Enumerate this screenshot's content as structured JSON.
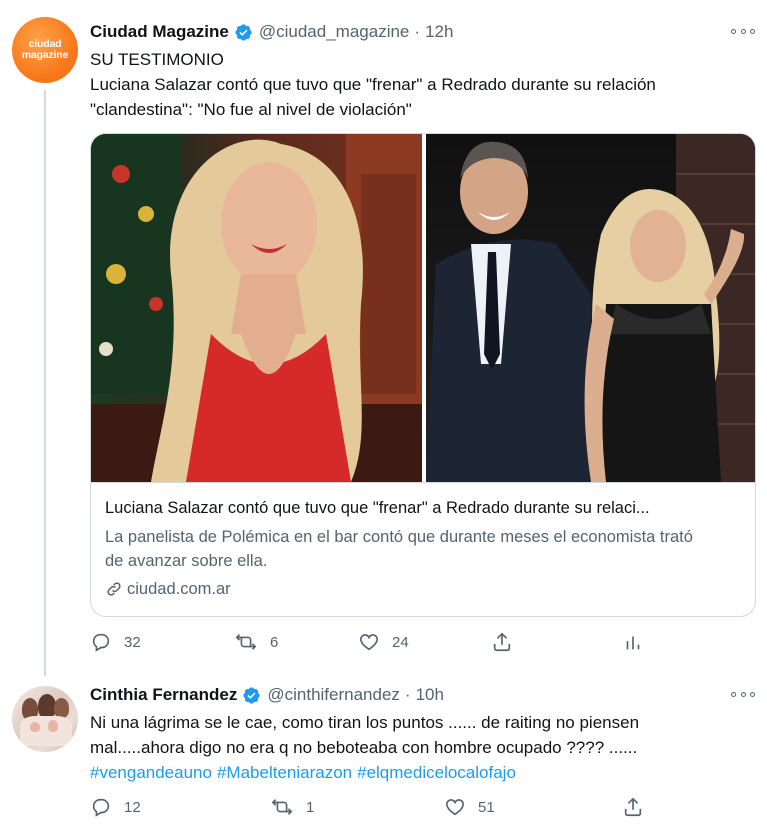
{
  "tweets": [
    {
      "author": {
        "name": "Ciudad Magazine",
        "handle": "@ciudad_magazine",
        "time": "12h",
        "avatar_text": [
          "ciudad",
          "magazine"
        ]
      },
      "text_lines": [
        "SU TESTIMONIO",
        "Luciana Salazar contó que tuvo que \"frenar\" a Redrado durante su relación",
        "\"clandestina\": \"No fue al nivel de violación\""
      ],
      "card": {
        "title": "Luciana Salazar contó que tuvo que \"frenar\" a Redrado durante su relaci...",
        "description": "La panelista de Polémica en el bar contó que durante meses el economista trató de avanzar sobre ella.",
        "domain": "ciudad.com.ar"
      },
      "actions": {
        "replies": "32",
        "retweets": "6",
        "likes": "24"
      }
    },
    {
      "author": {
        "name": "Cinthia Fernandez",
        "handle": "@cinthifernandez",
        "time": "10h"
      },
      "text_lines": [
        "Ni una lágrima se le cae, como tiran los puntos ...... de raiting no piensen",
        "mal.....ahora digo no era q no beboteaba con hombre ocupado ???? ......"
      ],
      "hashtags": [
        "#vengandeauno",
        "#Mabelteniarazon",
        "#elqmedicelocalofajo"
      ],
      "actions": {
        "replies": "12",
        "retweets": "1",
        "likes": "51"
      }
    }
  ],
  "colors": {
    "accent": "#1d9bf0",
    "secondary_text": "#536471",
    "verified": "#1d9bf0",
    "brand_orange": "#f97a1c"
  },
  "icons": [
    "verified-icon",
    "more-icon",
    "reply-icon",
    "retweet-icon",
    "like-icon",
    "share-icon",
    "analytics-icon",
    "link-icon"
  ]
}
